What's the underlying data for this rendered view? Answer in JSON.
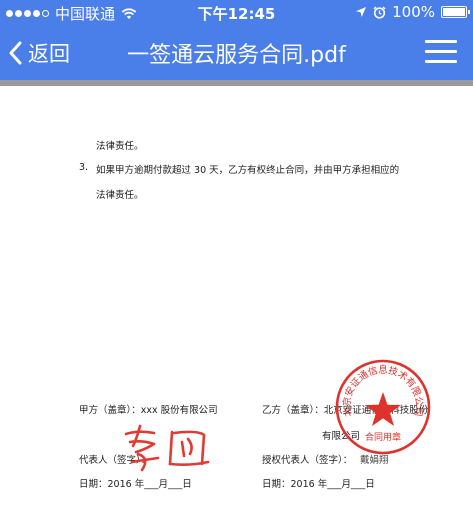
{
  "status_bar": {
    "carrier": "中国联通",
    "time": "下午12:45",
    "battery": "100%"
  },
  "nav": {
    "back_label": "返回",
    "title": "一签通云服务合同.pdf"
  },
  "document": {
    "text_liability_1": "法律责任。",
    "clause_number": "3.",
    "clause_text": "如果甲方逾期付款超过 30 天，乙方有权终止合同，并由甲方承担相应的",
    "text_liability_2": "法律责任。",
    "party_a": "甲方（盖章）：xxx 股份有限公司",
    "party_b_line1": "乙方（盖章）：北京安证通信息科技股份",
    "party_b_line2": "有限公司",
    "rep_a": "代表人（签字）：",
    "rep_b": "授权代表人（签字）：",
    "rep_b_name": "戴娟翔",
    "date_a": "日期：2016 年___月___日",
    "date_b": "日期：2016 年___月___日",
    "seal_text": "北京安证通信息技术有限公司",
    "seal_subtext": "合同用章"
  },
  "colors": {
    "nav_bg": "#4a7ee8",
    "seal_red": "#e0322d",
    "signature_red": "#e23a32"
  },
  "icons": [
    "back-chevron-icon",
    "menu-icon",
    "wifi-icon",
    "location-arrow-icon",
    "alarm-icon",
    "battery-icon"
  ]
}
